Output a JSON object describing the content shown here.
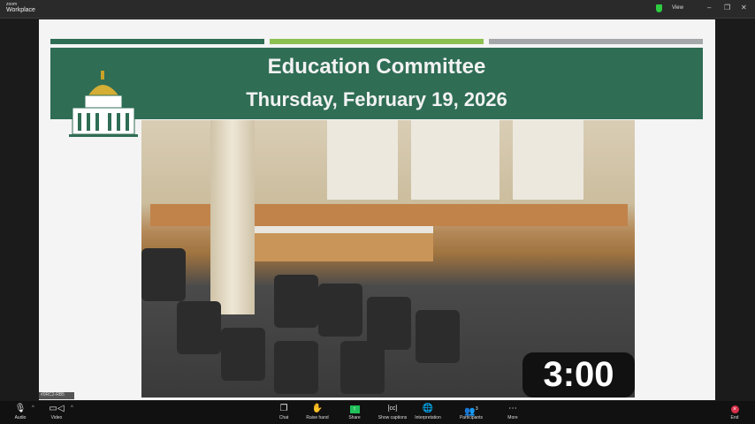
{
  "app": {
    "brand_small": "zoom",
    "brand": "Workplace",
    "view_label": "View"
  },
  "slide": {
    "title": "Education Committee",
    "date": "Thursday, February 19, 2026",
    "bar_colors": [
      "#2f6d55",
      "#8cc152",
      "#a4a8ab"
    ]
  },
  "timer": "3:00",
  "name_label": "#0RC2-RB5",
  "toolbar": {
    "audio": "Audio",
    "video": "Video",
    "chat": "Chat",
    "raise_hand": "Raise hand",
    "share": "Share",
    "captions": "Show captions",
    "interpretation": "Interpretation",
    "participants": "Participants",
    "participants_count": "3",
    "more": "More",
    "end": "End"
  }
}
